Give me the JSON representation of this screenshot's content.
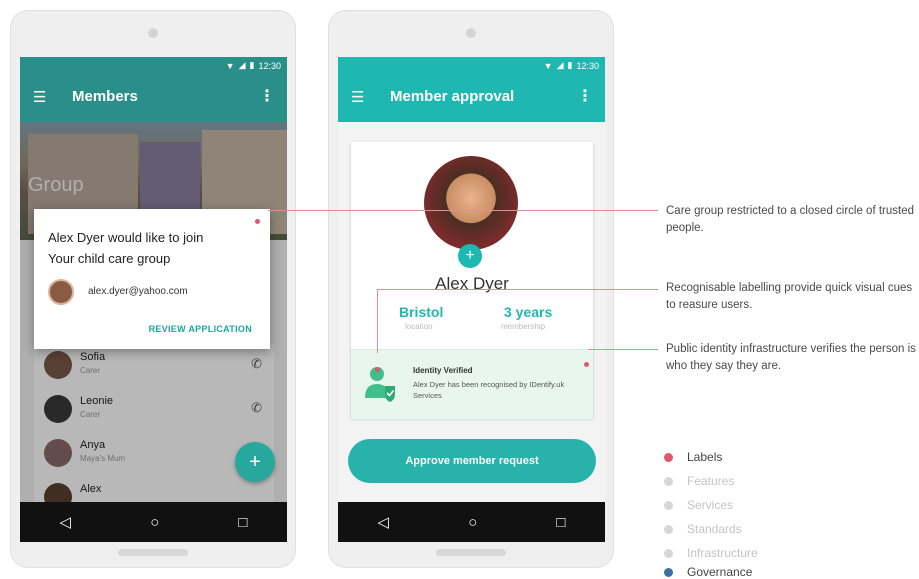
{
  "status_time": "12:30",
  "phone1": {
    "title": "Members",
    "photo_label": "Group",
    "dialog": {
      "line1": "Alex Dyer would like to join",
      "line2": "Your child care group",
      "email": "alex.dyer@yahoo.com",
      "action": "REVIEW APPLICATION"
    },
    "members": [
      {
        "name": "Sofia",
        "role": "Carer"
      },
      {
        "name": "Leonie",
        "role": "Carer"
      },
      {
        "name": "Anya",
        "role": "Maya's Mum"
      },
      {
        "name": "Alex",
        "role": ""
      }
    ],
    "fab": "+"
  },
  "phone2": {
    "title": "Member approval",
    "name": "Alex Dyer",
    "location_value": "Bristol",
    "location_label": "location",
    "membership_value": "3 years",
    "membership_label": "membership",
    "verify_title": "Identity Verified",
    "verify_text": "Alex Dyer has been recognised by IDentify.uk Services",
    "approve_button": "Approve member request"
  },
  "annotations": [
    "Care group restricted to a closed circle of trusted people.",
    "Recognisable labelling provide quick visual cues to reasure users.",
    "Public identity infrastructure verifies the person is who they say they are."
  ],
  "legend": [
    {
      "label": "Labels",
      "color": "#e0566e",
      "active": true
    },
    {
      "label": "Features",
      "color": "#d6d6d6",
      "active": false
    },
    {
      "label": "Services",
      "color": "#d6d6d6",
      "active": false
    },
    {
      "label": "Standards",
      "color": "#d6d6d6",
      "active": false
    },
    {
      "label": "Infrastructure",
      "color": "#d6d6d6",
      "active": false
    },
    {
      "label": "Governance",
      "color": "#3d6fa0",
      "active": false
    }
  ]
}
